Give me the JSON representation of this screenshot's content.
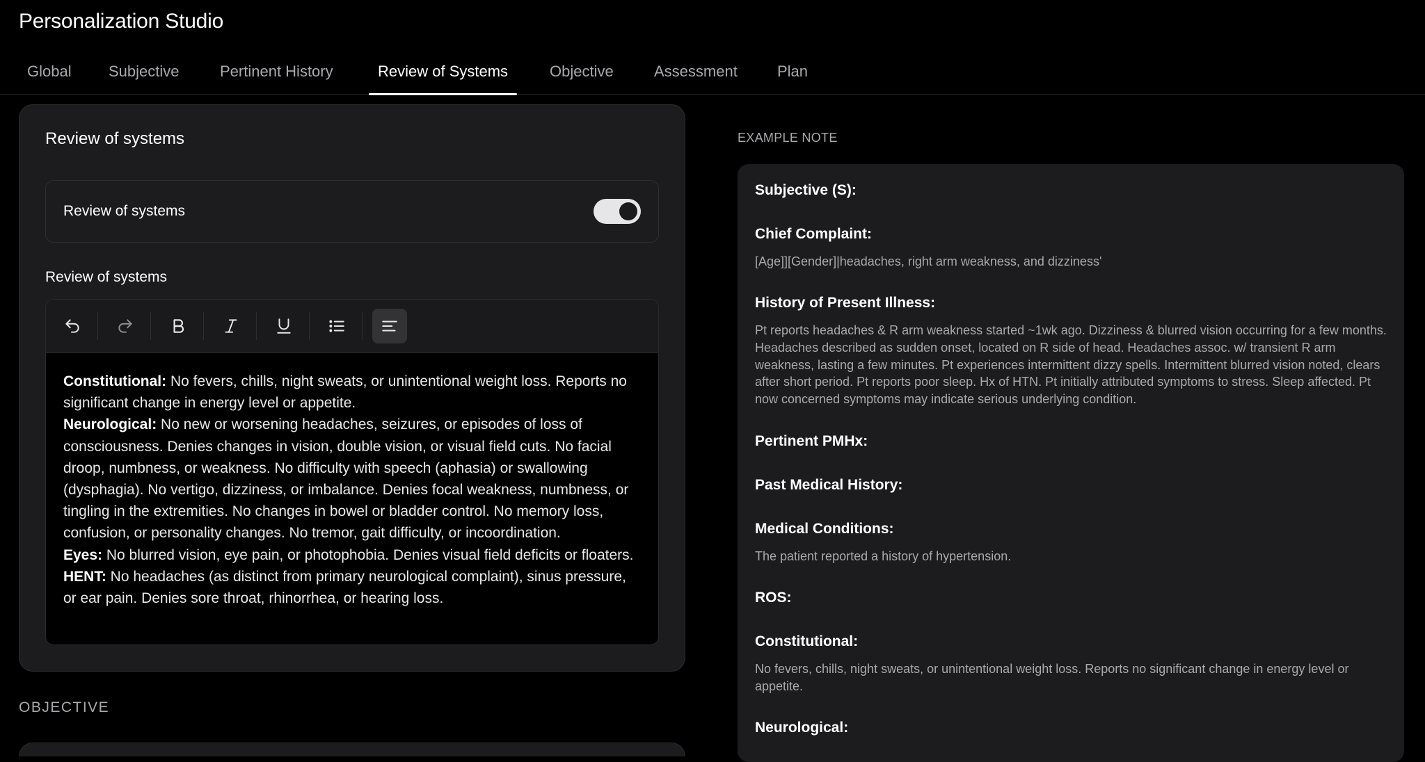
{
  "app": {
    "title": "Personalization Studio"
  },
  "tabs": [
    {
      "label": "Global",
      "active": false
    },
    {
      "label": "Subjective",
      "active": false
    },
    {
      "label": "Pertinent History",
      "active": false
    },
    {
      "label": "Review of Systems",
      "active": true
    },
    {
      "label": "Objective",
      "active": false
    },
    {
      "label": "Assessment",
      "active": false
    },
    {
      "label": "Plan",
      "active": false
    }
  ],
  "ros_card": {
    "title": "Review of systems",
    "toggle_label": "Review of systems",
    "toggle_on": true,
    "editor_label": "Review of systems",
    "toolbar": [
      "undo-icon",
      "redo-icon",
      "bold-icon",
      "italic-icon",
      "underline-icon",
      "bullet-list-icon",
      "align-left-icon"
    ],
    "content": [
      {
        "label": "Constitutional:",
        "text": " No fevers, chills, night sweats, or unintentional weight loss. Reports no significant change in energy level or appetite."
      },
      {
        "label": "Neurological:",
        "text": " No new or worsening headaches, seizures, or episodes of loss of consciousness. Denies changes in vision, double vision, or visual field cuts. No facial droop, numbness, or weakness. No difficulty with speech (aphasia) or swallowing (dysphagia). No vertigo, dizziness, or imbalance. Denies focal weakness, numbness, or tingling in the extremities. No changes in bowel or bladder control. No memory loss, confusion, or personality changes. No tremor, gait difficulty, or incoordination."
      },
      {
        "label": "Eyes:",
        "text": " No blurred vision, eye pain, or photophobia. Denies visual field deficits or floaters."
      },
      {
        "label": "HENT:",
        "text": " No headaches (as distinct from primary neurological complaint), sinus pressure, or ear pain. Denies sore throat, rhinorrhea, or hearing loss."
      }
    ]
  },
  "objective_section": {
    "heading": "OBJECTIVE"
  },
  "example_note": {
    "label": "EXAMPLE NOTE",
    "subjective_heading": "Subjective (S):",
    "chief_complaint_heading": "Chief Complaint:",
    "chief_complaint_text": "[Age]][Gender]|headaches, right arm weakness, and dizziness'",
    "hpi_heading": "History of Present Illness:",
    "hpi_text": "Pt reports headaches & R arm weakness started ~1wk ago. Dizziness & blurred vision occurring for a few months. Headaches described as sudden onset, located on R side of head. Headaches assoc. w/ transient R arm weakness, lasting a few minutes. Pt experiences intermittent dizzy spells. Intermittent blurred vision noted, clears after short period. Pt reports poor sleep. Hx of HTN. Pt initially attributed symptoms to stress. Sleep affected. Pt now concerned symptoms may indicate serious underlying condition.",
    "pmhx_heading": "Pertinent PMHx:",
    "pmh_heading": "Past Medical History:",
    "conditions_heading": "Medical Conditions:",
    "conditions_text": "The patient reported a history of hypertension.",
    "ros_heading": "ROS:",
    "constitutional_heading": "Constitutional:",
    "constitutional_text": "No fevers, chills, night sweats, or unintentional weight loss. Reports no significant change in energy level or appetite.",
    "neurological_heading": "Neurological:"
  }
}
